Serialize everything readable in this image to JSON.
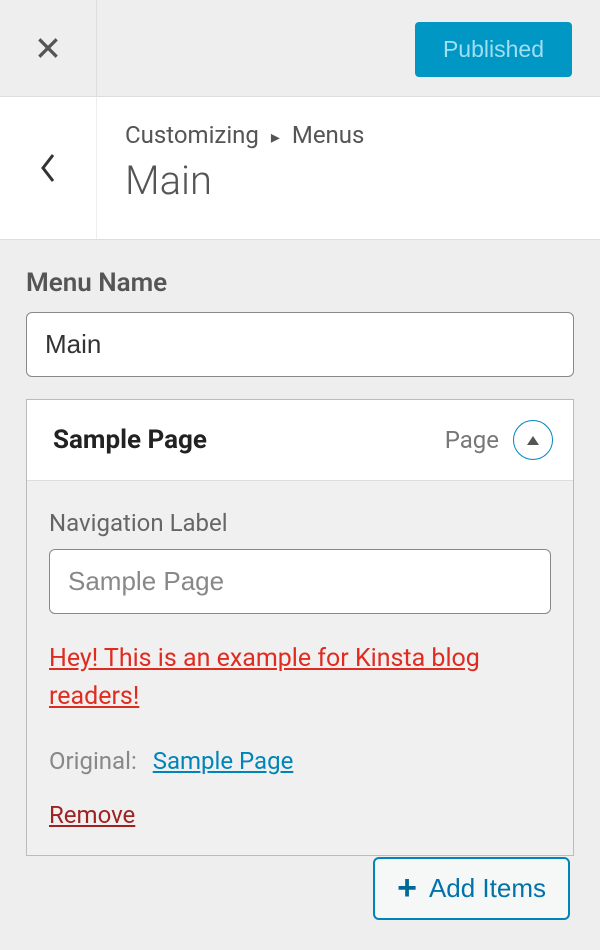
{
  "topbar": {
    "publish_label": "Published"
  },
  "breadcrumb": {
    "root": "Customizing",
    "parent": "Menus",
    "title": "Main"
  },
  "menu_name": {
    "label": "Menu Name",
    "value": "Main"
  },
  "menu_item": {
    "title": "Sample Page",
    "type": "Page",
    "nav_label_label": "Navigation Label",
    "nav_label_value": "Sample Page",
    "description_text": "Hey! This is an example for Kinsta blog readers!",
    "original_label": "Original:",
    "original_link": "Sample Page",
    "remove_label": "Remove"
  },
  "add_items_label": "Add Items"
}
